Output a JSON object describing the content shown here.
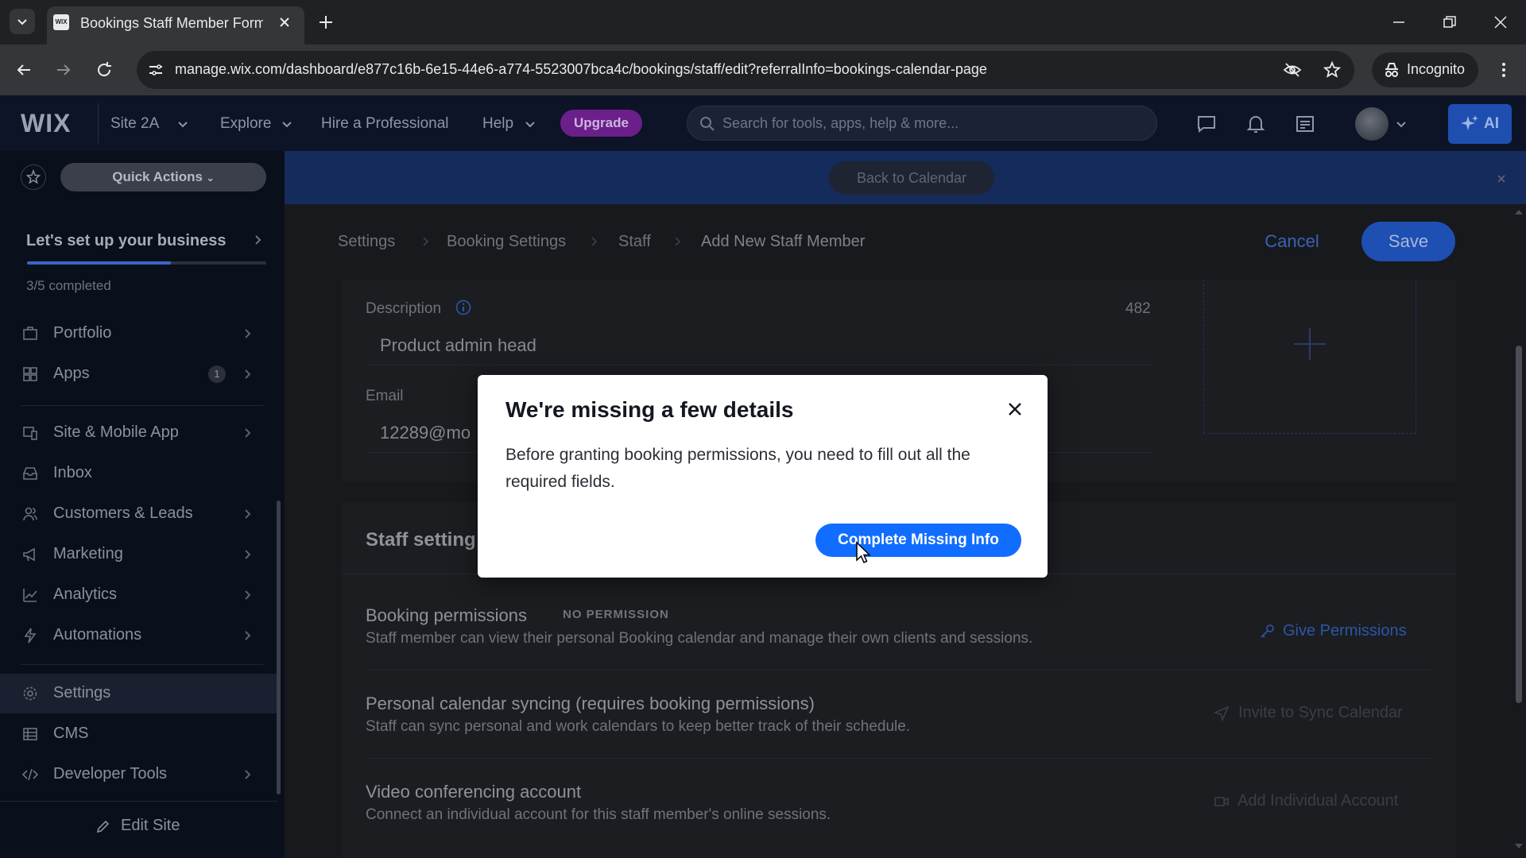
{
  "browser": {
    "tab_title": "Bookings Staff Member Form | W",
    "url": "manage.wix.com/dashboard/e877c16b-6e15-44e6-a774-5523007bca4c/bookings/staff/edit?referralInfo=bookings-calendar-page",
    "incognito_label": "Incognito"
  },
  "topbar": {
    "logo": "WIX",
    "site_name": "Site 2A",
    "explore": "Explore",
    "hire": "Hire a Professional",
    "help": "Help",
    "upgrade": "Upgrade",
    "search_placeholder": "Search for tools, apps, help & more...",
    "ai_label": "AI"
  },
  "sidebar": {
    "quick_actions": "Quick Actions",
    "setup_title": "Let's set up your business",
    "setup_progress": "3/5 completed",
    "setup_fraction": 0.6,
    "items": [
      {
        "label": "Portfolio",
        "icon": "portfolio-icon"
      },
      {
        "label": "Apps",
        "icon": "apps-icon",
        "badge": "1"
      },
      {
        "label": "Site & Mobile App",
        "icon": "site-mobile-icon"
      },
      {
        "label": "Inbox",
        "icon": "inbox-icon"
      },
      {
        "label": "Customers & Leads",
        "icon": "customers-icon"
      },
      {
        "label": "Marketing",
        "icon": "marketing-icon"
      },
      {
        "label": "Analytics",
        "icon": "analytics-icon"
      },
      {
        "label": "Automations",
        "icon": "automations-icon"
      },
      {
        "label": "Settings",
        "icon": "settings-icon"
      },
      {
        "label": "CMS",
        "icon": "cms-icon"
      },
      {
        "label": "Developer Tools",
        "icon": "developer-tools-icon"
      }
    ],
    "edit_site": "Edit Site"
  },
  "banner": {
    "back_to_calendar": "Back to Calendar"
  },
  "header": {
    "breadcrumbs": [
      "Settings",
      "Booking Settings",
      "Staff",
      "Add New Staff Member"
    ],
    "cancel": "Cancel",
    "save": "Save"
  },
  "form": {
    "description_label": "Description",
    "description_value": "Product admin head",
    "char_count": "482",
    "email_label": "Email",
    "email_value": "12289@mo"
  },
  "staff_settings": {
    "heading": "Staff setting",
    "booking_permissions": {
      "title": "Booking permissions",
      "badge": "NO PERMISSION",
      "desc": "Staff member can view their personal Booking calendar and manage their own clients and sessions.",
      "action": "Give Permissions"
    },
    "calendar_sync": {
      "title": "Personal calendar syncing (requires booking permissions)",
      "desc": "Staff can sync personal and work calendars to keep better track of their schedule.",
      "action": "Invite to Sync Calendar"
    },
    "video": {
      "title": "Video conferencing account",
      "desc": "Connect an individual account for this staff member's online sessions.",
      "action": "Add Individual Account"
    }
  },
  "modal": {
    "title": "We're missing a few details",
    "body": "Before granting booking permissions, you need to fill out all the required fields.",
    "button": "Complete Missing Info"
  },
  "colors": {
    "accent": "#116dff",
    "upgrade": "#6b1f8a",
    "banner": "#142b5c"
  }
}
